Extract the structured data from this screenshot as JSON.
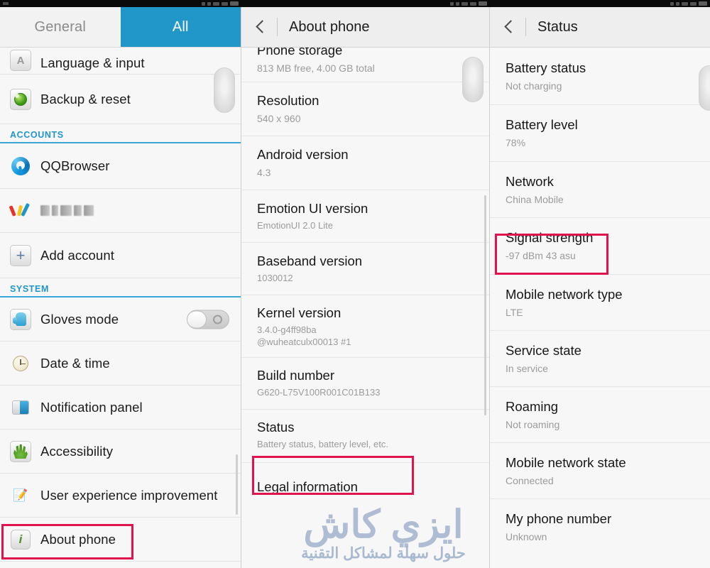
{
  "statusbar": {
    "segments": 3
  },
  "left_panel": {
    "tabs": [
      {
        "label": "General",
        "active": false
      },
      {
        "label": "All",
        "active": true
      }
    ],
    "items": [
      {
        "icon": "language-icon",
        "label": "Language & input",
        "type": "nav",
        "partial": true
      },
      {
        "icon": "backup-reset-icon",
        "label": "Backup & reset",
        "type": "nav"
      },
      {
        "icon": "",
        "label": "ACCOUNTS",
        "type": "section"
      },
      {
        "icon": "qqbrowser-icon",
        "label": "QQBrowser",
        "type": "nav"
      },
      {
        "icon": "weibo-v-icon",
        "label": "",
        "type": "account-blurred"
      },
      {
        "icon": "add-account-icon",
        "label": "Add account",
        "type": "nav"
      },
      {
        "icon": "",
        "label": "SYSTEM",
        "type": "section"
      },
      {
        "icon": "gloves-mode-icon",
        "label": "Gloves mode",
        "type": "toggle",
        "toggle_state": "off"
      },
      {
        "icon": "clock-icon",
        "label": "Date & time",
        "type": "nav"
      },
      {
        "icon": "notification-panel-icon",
        "label": "Notification panel",
        "type": "nav"
      },
      {
        "icon": "accessibility-hand-icon",
        "label": "Accessibility",
        "type": "nav"
      },
      {
        "icon": "user-experience-icon",
        "label": "User experience improvement",
        "type": "nav"
      },
      {
        "icon": "about-phone-info-icon",
        "label": "About phone",
        "type": "nav",
        "highlighted": true
      }
    ]
  },
  "mid_panel": {
    "header": {
      "back_icon": "back-chevron-icon",
      "title": "About phone"
    },
    "rows": [
      {
        "title": "Phone storage",
        "value": "813 MB free, 4.00 GB total",
        "partial": true
      },
      {
        "title": "Resolution",
        "value": "540 x 960"
      },
      {
        "title": "Android version",
        "value": "4.3"
      },
      {
        "title": "Emotion UI version",
        "value": "EmotionUI 2.0 Lite"
      },
      {
        "title": "Baseband version",
        "value": "1030012"
      },
      {
        "title": "Kernel version",
        "value": "3.4.0-g4ff98ba\n@wuheatculx00013 #1"
      },
      {
        "title": "Build number",
        "value": "G620-L75V100R001C01B133"
      },
      {
        "title": "Status",
        "value": "Battery status, battery level, etc.",
        "highlighted": true
      },
      {
        "title": "Legal information",
        "value": ""
      }
    ]
  },
  "right_panel": {
    "header": {
      "back_icon": "back-chevron-icon",
      "title": "Status"
    },
    "rows": [
      {
        "title": "Battery status",
        "value": "Not charging"
      },
      {
        "title": "Battery level",
        "value": "78%"
      },
      {
        "title": "Network",
        "value": "China Mobile"
      },
      {
        "title": "Signal strength",
        "value": "-97 dBm   43 asu",
        "highlighted": true
      },
      {
        "title": "Mobile network type",
        "value": "LTE"
      },
      {
        "title": "Service state",
        "value": "In service"
      },
      {
        "title": "Roaming",
        "value": "Not roaming"
      },
      {
        "title": "Mobile network state",
        "value": "Connected"
      },
      {
        "title": "My phone number",
        "value": "Unknown"
      }
    ]
  },
  "watermark": {
    "main": "ايزي كاش",
    "sub": "حلول سهلة لمشاكل التقنية"
  },
  "colors": {
    "accent": "#2196c8",
    "highlight": "#e0134f",
    "title_text": "#171717",
    "value_text": "#9b9b9b"
  }
}
